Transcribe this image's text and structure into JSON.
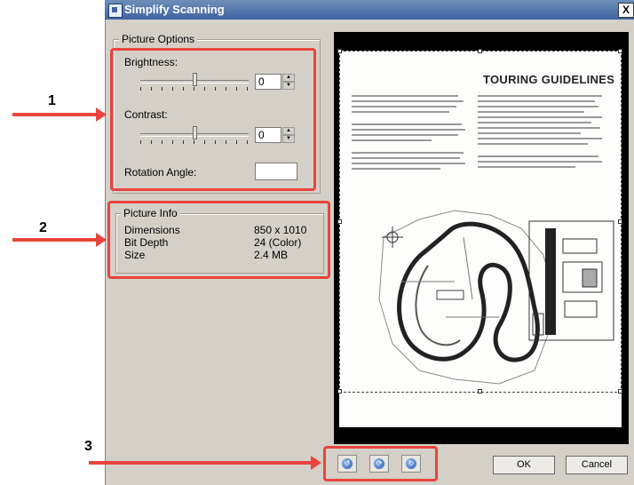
{
  "window": {
    "title": "Simplify Scanning",
    "close_label": "X"
  },
  "picture_options": {
    "legend": "Picture Options",
    "brightness": {
      "label": "Brightness:",
      "value": "0",
      "slider_fraction": 0.5
    },
    "contrast": {
      "label": "Contrast:",
      "value": "0",
      "slider_fraction": 0.5
    },
    "rotation": {
      "label": "Rotation Angle:",
      "value": ""
    }
  },
  "picture_info": {
    "legend": "Picture Info",
    "rows": [
      {
        "label": "Dimensions",
        "value": "850 x 1010"
      },
      {
        "label": "Bit Depth",
        "value": "24 (Color)"
      },
      {
        "label": "Size",
        "value": "2.4 MB"
      }
    ]
  },
  "preview": {
    "document_title": "TOURING GUIDELINES"
  },
  "rotate_buttons": [
    {
      "icon": "rotate-left-icon"
    },
    {
      "icon": "refresh-icon"
    },
    {
      "icon": "rotate-right-icon"
    }
  ],
  "buttons": {
    "ok_label": "OK",
    "cancel_label": "Cancel"
  },
  "annotations": [
    {
      "number": "1"
    },
    {
      "number": "2"
    },
    {
      "number": "3"
    }
  ],
  "colors": {
    "annotation_red": "#e9443e",
    "titlebar_blue": "#3f63a0",
    "dialog_gray": "#d4d0c8"
  }
}
